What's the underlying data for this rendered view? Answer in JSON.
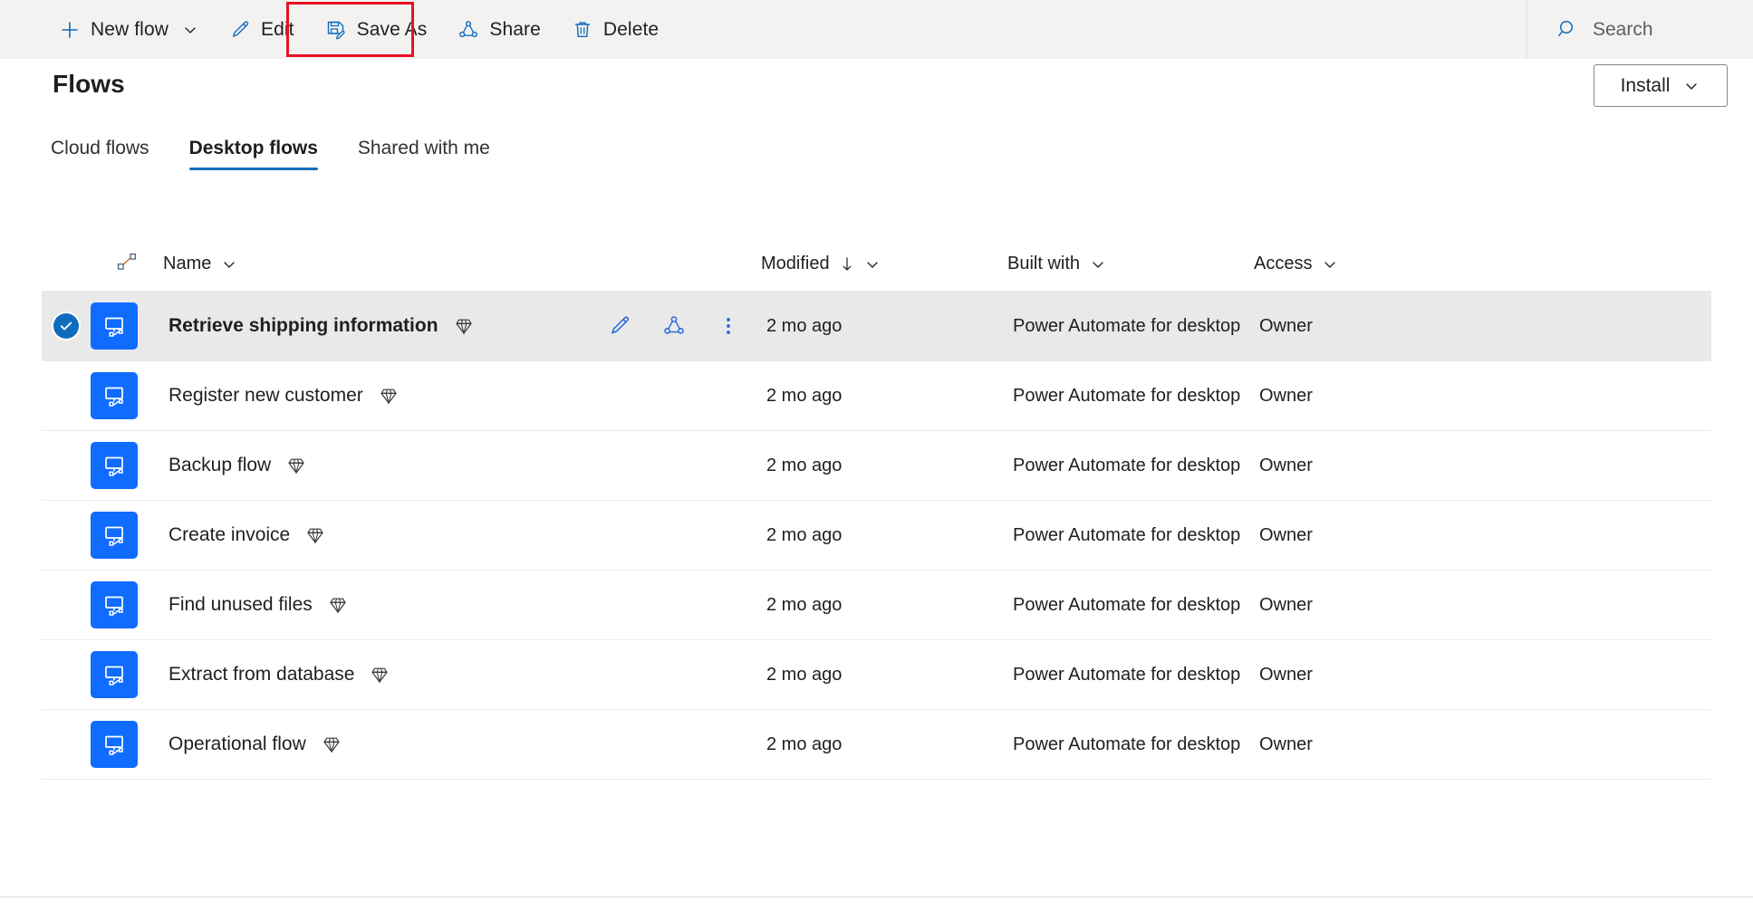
{
  "commandbar": {
    "buttons": [
      {
        "label": "New flow",
        "icon": "plus-icon",
        "has_chevron": true
      },
      {
        "label": "Edit",
        "icon": "pencil-icon",
        "has_chevron": false
      },
      {
        "label": "Save As",
        "icon": "save-as-icon",
        "has_chevron": false,
        "highlighted": true
      },
      {
        "label": "Share",
        "icon": "share-icon",
        "has_chevron": false
      },
      {
        "label": "Delete",
        "icon": "trash-icon",
        "has_chevron": false
      }
    ],
    "search": {
      "placeholder": "Search",
      "icon": "search-icon"
    },
    "highlight_color": "#e81123"
  },
  "header": {
    "title": "Flows",
    "install": {
      "label": "Install",
      "icon": "chevron-down-icon"
    }
  },
  "tabs": [
    {
      "label": "Cloud flows",
      "active": false
    },
    {
      "label": "Desktop flows",
      "active": true
    },
    {
      "label": "Shared with me",
      "active": false
    }
  ],
  "table": {
    "columns": {
      "flow_icon": "flow-connector-icon",
      "name": "Name",
      "modified": "Modified",
      "modified_sort": "descending",
      "built_with": "Built with",
      "access": "Access"
    },
    "row_actions": [
      {
        "name": "edit-icon",
        "label": "Edit"
      },
      {
        "name": "share-icon",
        "label": "Share"
      },
      {
        "name": "more-options-icon",
        "label": "More commands"
      }
    ],
    "rows": [
      {
        "name": "Retrieve shipping information",
        "premium": true,
        "modified": "2 mo ago",
        "built_with": "Power Automate for desktop",
        "access": "Owner",
        "selected": true
      },
      {
        "name": "Register new customer",
        "premium": true,
        "modified": "2 mo ago",
        "built_with": "Power Automate for desktop",
        "access": "Owner",
        "selected": false
      },
      {
        "name": "Backup flow",
        "premium": true,
        "modified": "2 mo ago",
        "built_with": "Power Automate for desktop",
        "access": "Owner",
        "selected": false
      },
      {
        "name": "Create invoice",
        "premium": true,
        "modified": "2 mo ago",
        "built_with": "Power Automate for desktop",
        "access": "Owner",
        "selected": false
      },
      {
        "name": "Find unused files",
        "premium": true,
        "modified": "2 mo ago",
        "built_with": "Power Automate for desktop",
        "access": "Owner",
        "selected": false
      },
      {
        "name": "Extract from database",
        "premium": true,
        "modified": "2 mo ago",
        "built_with": "Power Automate for desktop",
        "access": "Owner",
        "selected": false
      },
      {
        "name": "Operational flow",
        "premium": true,
        "modified": "2 mo ago",
        "built_with": "Power Automate for desktop",
        "access": "Owner",
        "selected": false
      }
    ]
  },
  "colors": {
    "accent": "#0f6cbd",
    "tile_blue": "#0f6cff",
    "commandbar_bg": "#f3f2f1",
    "selected_row_bg": "#e9e9e9",
    "highlight_red": "#e81123"
  }
}
